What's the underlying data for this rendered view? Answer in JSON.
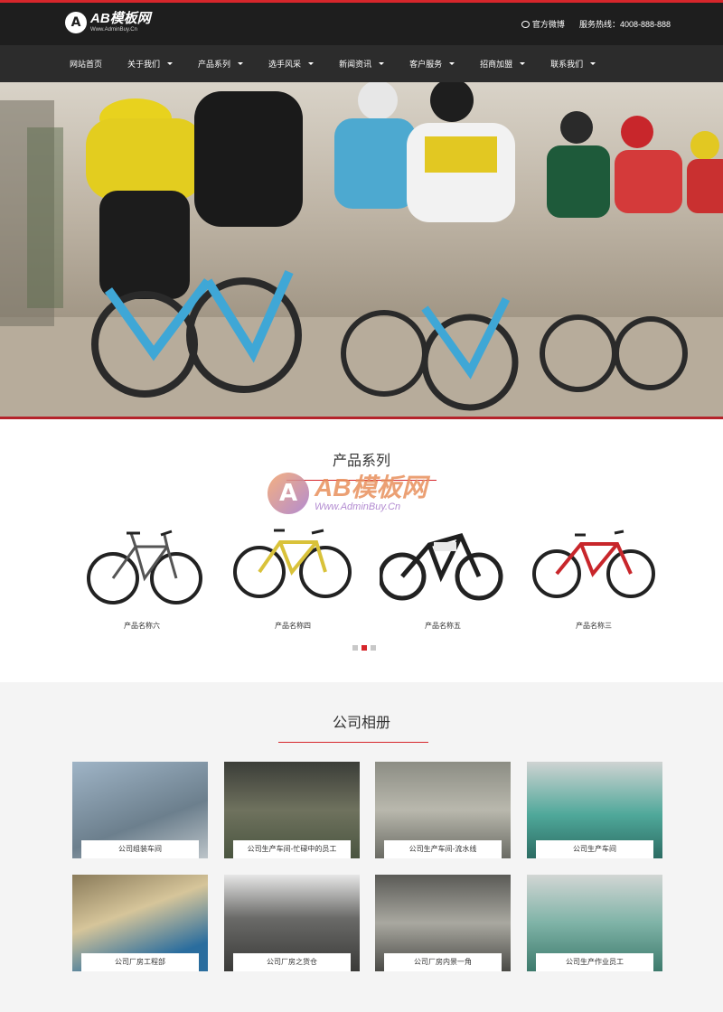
{
  "header": {
    "logo_title": "AB模板网",
    "logo_sub": "Www.AdminBuy.Cn",
    "weibo": "官方微博",
    "hotline": "服务热线：4008-888-888"
  },
  "nav": {
    "items": [
      {
        "label": "网站首页",
        "caret": false
      },
      {
        "label": "关于我们",
        "caret": true
      },
      {
        "label": "产品系列",
        "caret": true
      },
      {
        "label": "选手风采",
        "caret": true
      },
      {
        "label": "新闻资讯",
        "caret": true
      },
      {
        "label": "客户服务",
        "caret": true
      },
      {
        "label": "招商加盟",
        "caret": true
      },
      {
        "label": "联系我们",
        "caret": true
      }
    ]
  },
  "products": {
    "title": "产品系列",
    "items": [
      {
        "label": "产品名称六",
        "color": "#333333"
      },
      {
        "label": "产品名称四",
        "color": "#d9c23a"
      },
      {
        "label": "产品名称五",
        "color": "#1f1f1f"
      },
      {
        "label": "产品名称三",
        "color": "#c8262b"
      }
    ],
    "carousel_active": 1,
    "carousel_count": 3
  },
  "watermark": {
    "title": "AB模板网",
    "sub": "Www.AdminBuy.Cn"
  },
  "album": {
    "title": "公司相册",
    "items": [
      {
        "caption": "公司组装车间"
      },
      {
        "caption": "公司生产车间-忙碌中的员工"
      },
      {
        "caption": "公司生产车间-流水线"
      },
      {
        "caption": "公司生产车间"
      },
      {
        "caption": "公司厂房工程部"
      },
      {
        "caption": "公司厂房之货仓"
      },
      {
        "caption": "公司厂房内景一角"
      },
      {
        "caption": "公司生产作业员工"
      }
    ]
  },
  "colors": {
    "accent": "#d6262b",
    "header_bg": "#1e1e1e",
    "nav_bg": "#2c2c2c"
  }
}
